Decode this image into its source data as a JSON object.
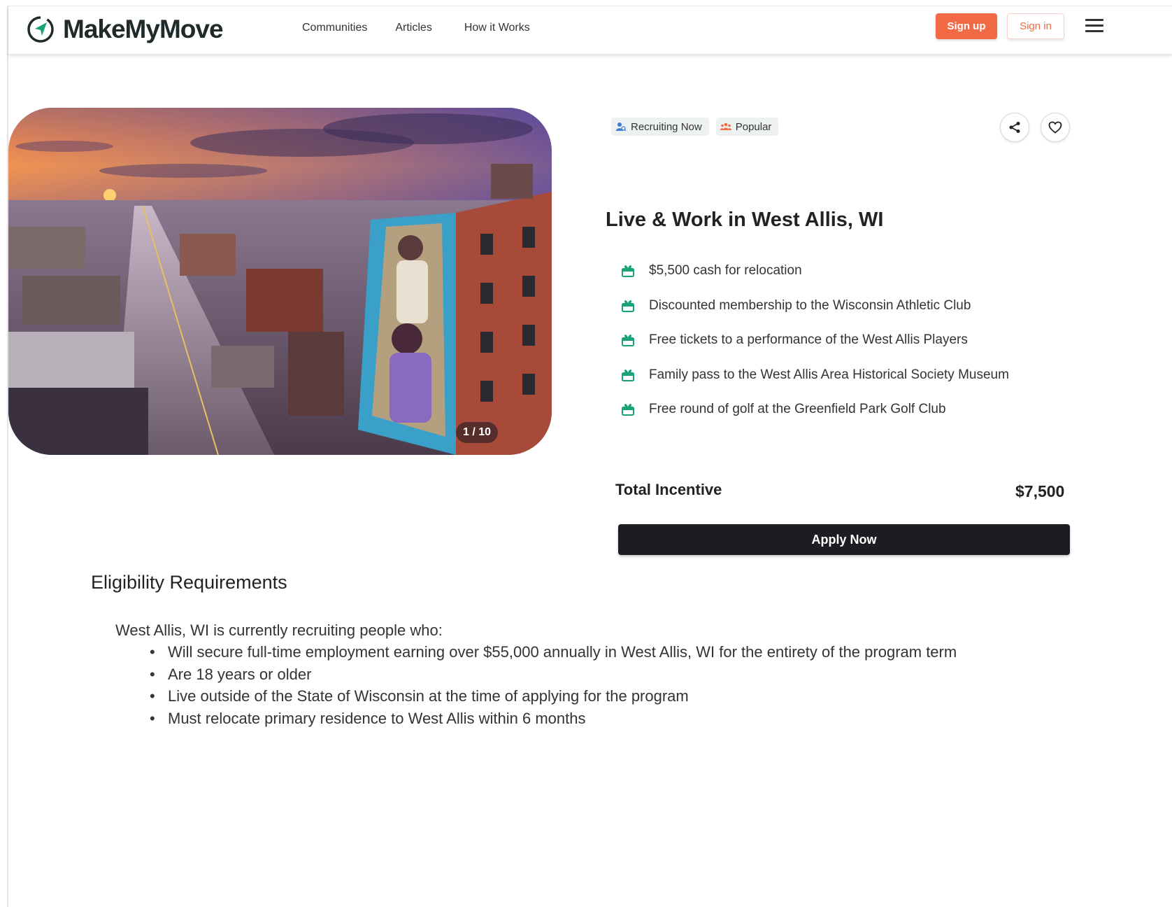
{
  "brand": {
    "name": "MakeMyMove",
    "accent_color": "#f26a45",
    "logo_color": "#1f2a2a",
    "logo_arrow_color": "#1aa37a"
  },
  "header": {
    "nav": [
      "Communities",
      "Articles",
      "How it Works"
    ],
    "signup_label": "Sign up",
    "signin_label": "Sign in",
    "menu_icon": "hamburger-menu-icon"
  },
  "gallery": {
    "counter": "1 / 10"
  },
  "badges": [
    {
      "label": "Recruiting Now",
      "icon": "recruiting-icon",
      "color": "#3b7dd8"
    },
    {
      "label": "Popular",
      "icon": "people-group-icon",
      "color": "#f26a45"
    }
  ],
  "actions": {
    "share_icon": "share-icon",
    "favorite_icon": "heart-icon"
  },
  "listing": {
    "title": "Live & Work in West Allis, WI",
    "benefits": [
      "$5,500 cash for relocation",
      "Discounted membership to the Wisconsin Athletic Club",
      "Free tickets to a performance of the West Allis Players",
      "Family pass to the West Allis Area Historical Society Museum",
      "Free round of golf at the Greenfield Park Golf Club"
    ],
    "benefit_icon": "gift-icon",
    "benefit_icon_color": "#1aa37a",
    "total_label": "Total Incentive",
    "total_value": "$7,500",
    "apply_label": "Apply Now"
  },
  "eligibility": {
    "title": "Eligibility Requirements",
    "intro": "West Allis, WI is currently recruiting people who:",
    "items": [
      "Will secure full-time employment earning over $55,000 annually in West Allis, WI for the entirety of the program term",
      "Are 18 years or older",
      "Live outside of the State of Wisconsin at the time of applying for the program",
      "Must relocate primary residence to West Allis within 6 months"
    ]
  }
}
